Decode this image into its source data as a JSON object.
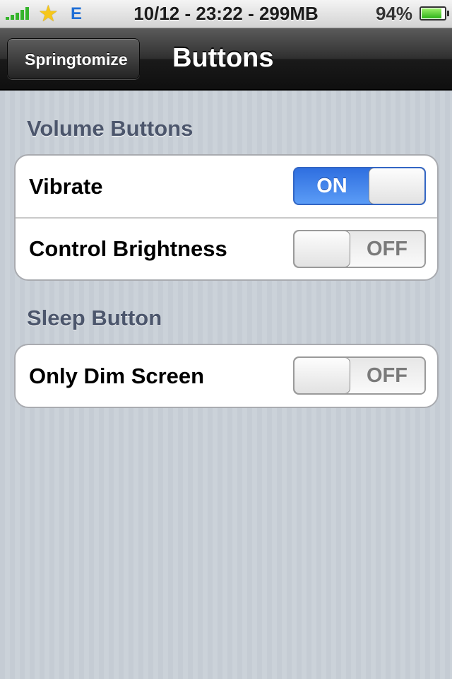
{
  "status_bar": {
    "center_text": "10/12 - 23:22 - 299MB",
    "carrier": "E",
    "battery_percent": "94%",
    "battery_level": 0.94,
    "icons": [
      "signal-icon",
      "star-icon",
      "battery-icon"
    ]
  },
  "nav": {
    "back_label": "Springtomize",
    "title": "Buttons"
  },
  "sections": [
    {
      "header": "Volume Buttons",
      "rows": [
        {
          "label": "Vibrate",
          "switch_state": "on",
          "switch_text": "ON"
        },
        {
          "label": "Control Brightness",
          "switch_state": "off",
          "switch_text": "OFF"
        }
      ]
    },
    {
      "header": "Sleep Button",
      "rows": [
        {
          "label": "Only Dim Screen",
          "switch_state": "off",
          "switch_text": "OFF"
        }
      ]
    }
  ],
  "colors": {
    "switch_on": "#3a7ae8",
    "section_header": "#4c566c",
    "background": "#c5ccd4"
  }
}
